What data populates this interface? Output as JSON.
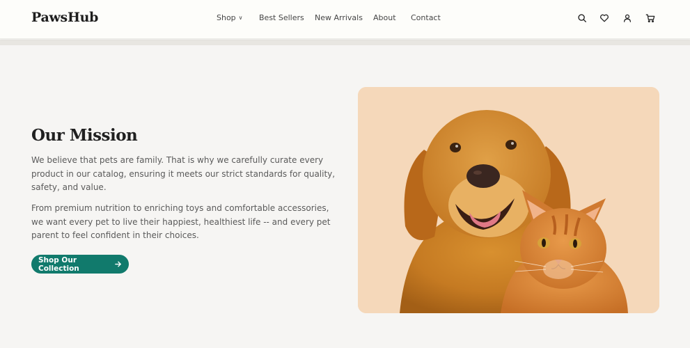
{
  "header": {
    "logo": "PawsHub",
    "nav": [
      {
        "label": "Shop",
        "has_dropdown": true
      },
      {
        "label": "Best Sellers"
      },
      {
        "label": "New Arrivals"
      },
      {
        "label": "About"
      },
      {
        "label": "Contact"
      }
    ],
    "icons": [
      "search-icon",
      "heart-icon",
      "user-icon",
      "cart-icon"
    ]
  },
  "mission": {
    "title": "Our Mission",
    "paragraph1": "We believe that pets are family. That is why we carefully curate every product in our catalog, ensuring it meets our strict standards for quality, safety, and value.",
    "paragraph2": "From premium nutrition to enriching toys and comfortable accessories, we want every pet to live their happiest, healthiest life -- and every pet parent to feel confident in their choices.",
    "cta_label": "Shop Our Collection"
  },
  "hero_image": {
    "subject": "golden retriever and orange tabby cat"
  },
  "colors": {
    "accent": "#117a6c",
    "background": "#f6f5f3",
    "header_bg": "#fdfdfa",
    "image_bg": "#f5d8ba"
  }
}
